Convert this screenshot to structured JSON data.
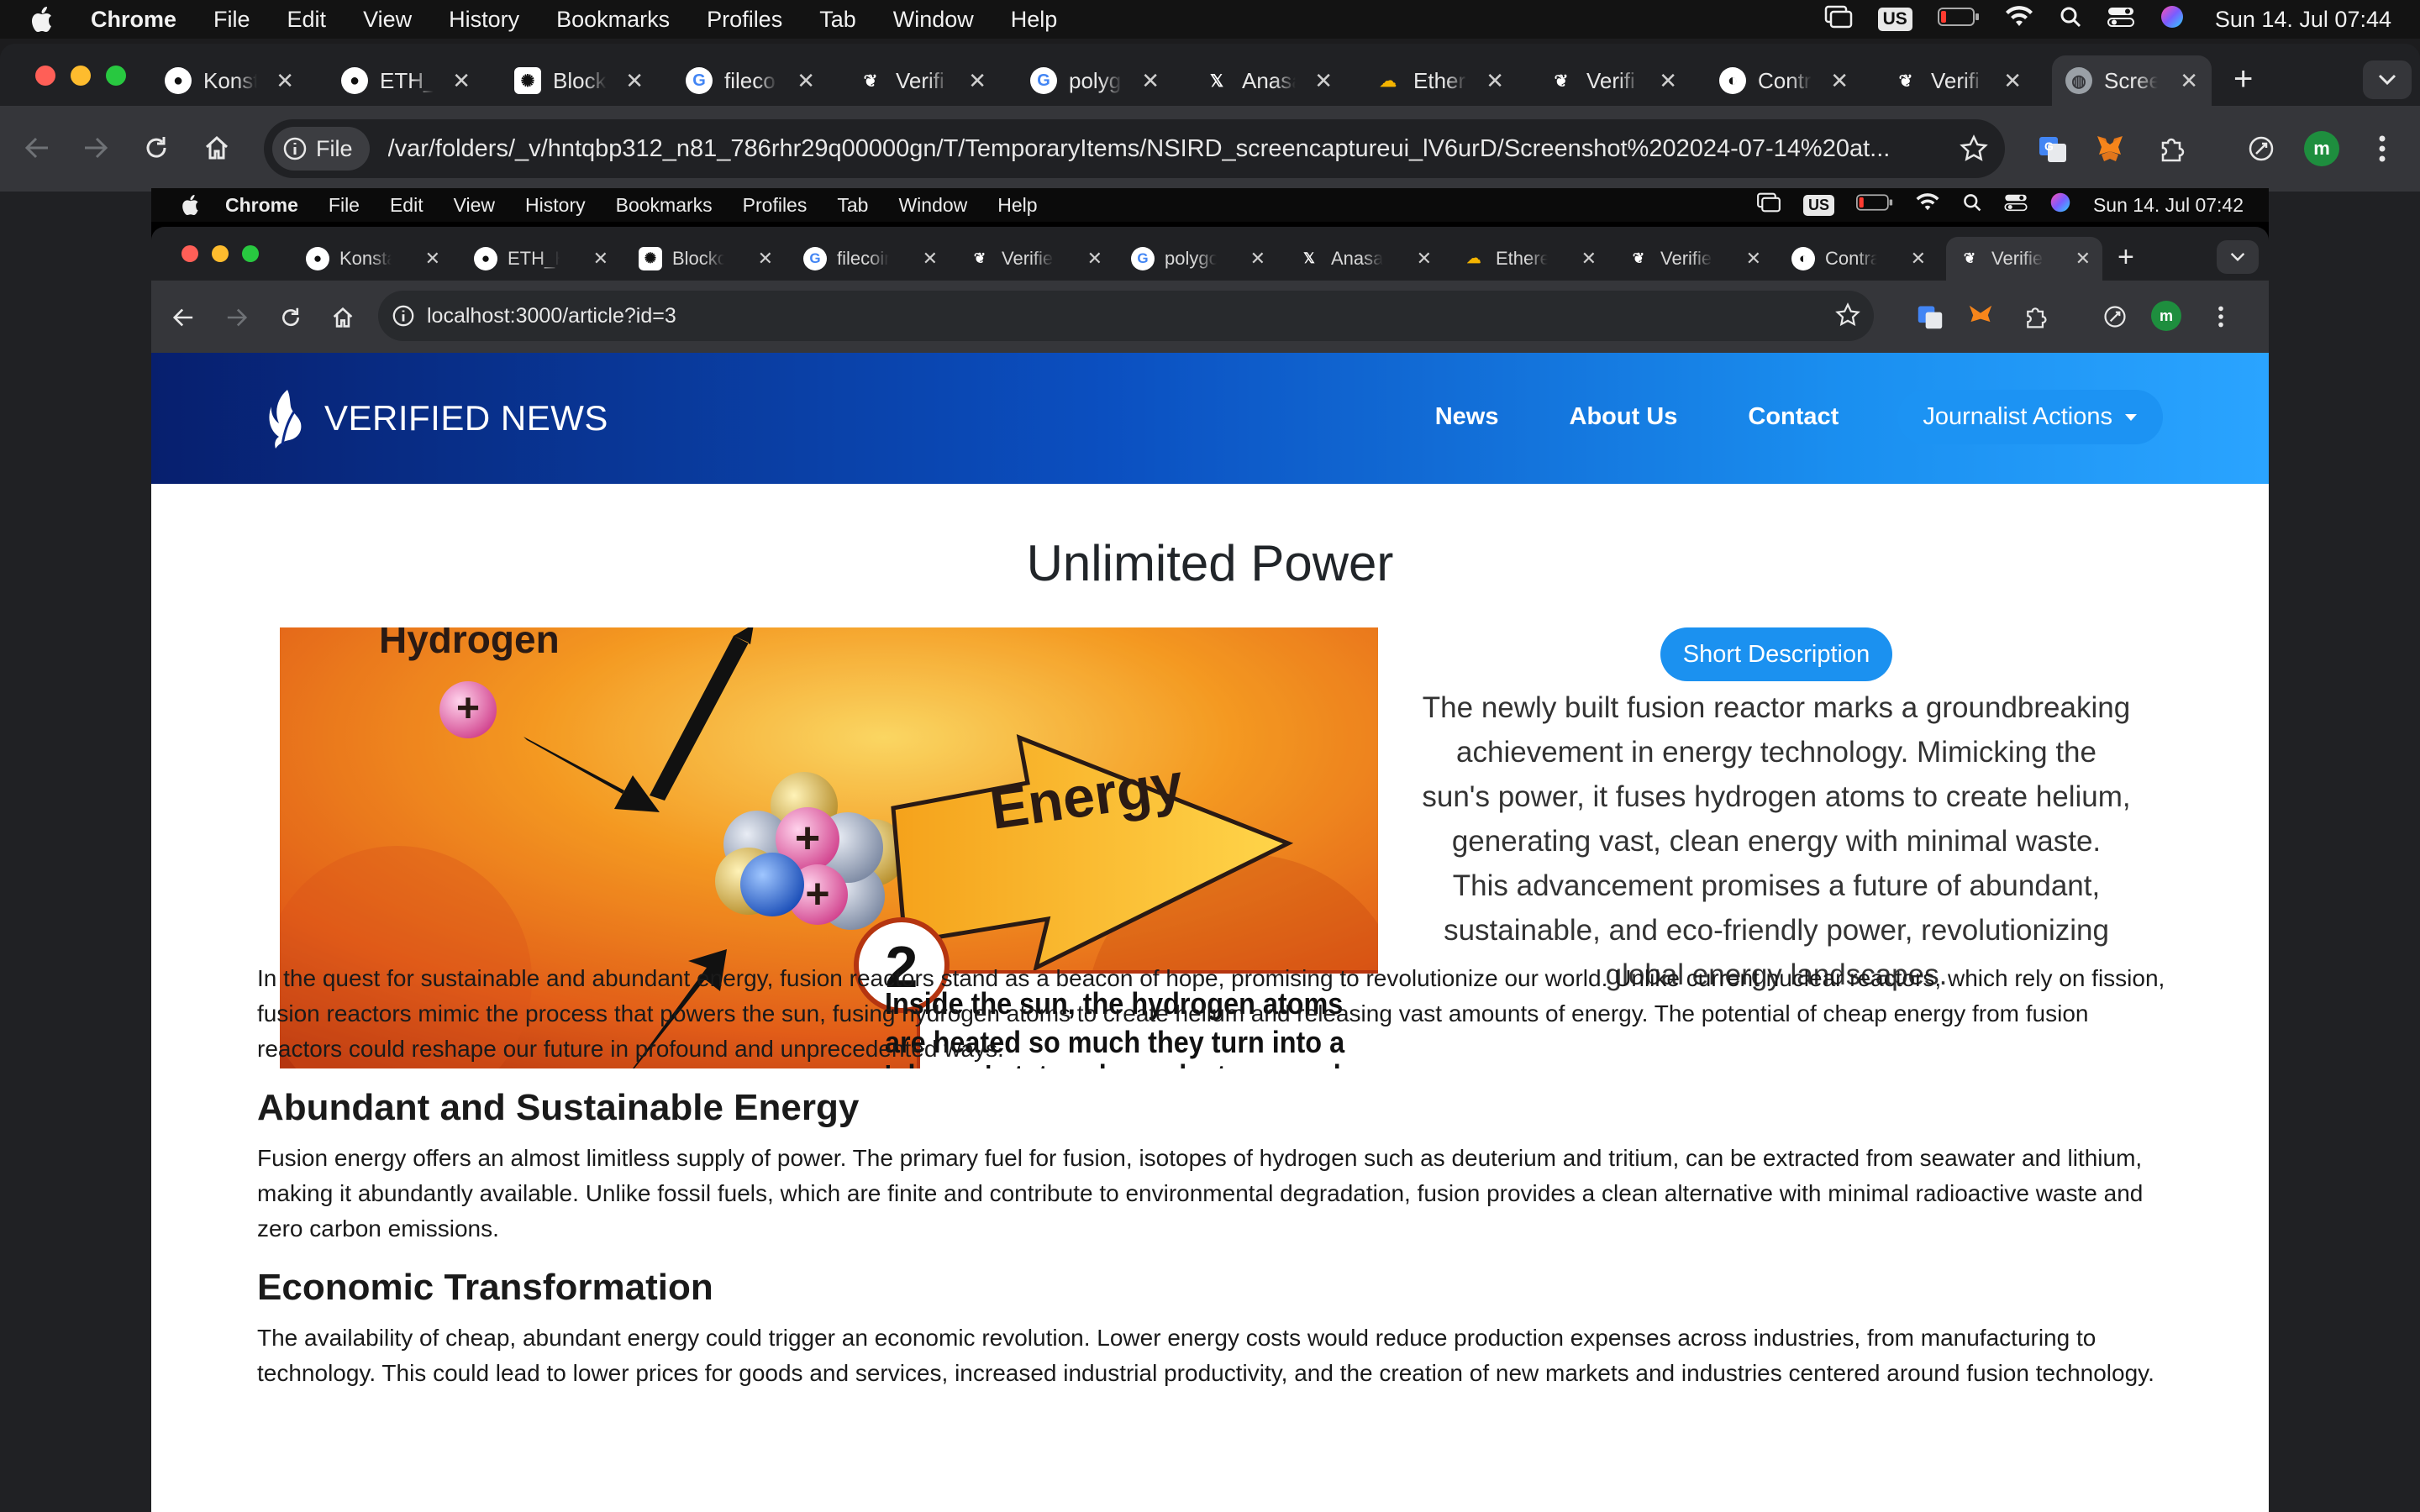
{
  "os_menubar": {
    "items": [
      "Chrome",
      "File",
      "Edit",
      "View",
      "History",
      "Bookmarks",
      "Profiles",
      "Tab",
      "Window",
      "Help"
    ],
    "keyboard": "US",
    "clock": "Sun 14. Jul 07:44"
  },
  "outer_browser": {
    "tabs": [
      "Konst",
      "ETH_",
      "Block",
      "fileco",
      "Verifi",
      "polyg",
      "Anasa",
      "Ether",
      "Verifi",
      "Contr",
      "Verifi",
      "Scree"
    ],
    "address_chip": "File",
    "url": "/var/folders/_v/hntqbp312_n81_786rhr29q00000gn/T/TemporaryItems/NSIRD_screencaptureui_lV6urD/Screenshot%202024-07-14%20at...",
    "profile_initial": "m"
  },
  "inner_menubar": {
    "items": [
      "Chrome",
      "File",
      "Edit",
      "View",
      "History",
      "Bookmarks",
      "Profiles",
      "Tab",
      "Window",
      "Help"
    ],
    "keyboard": "US",
    "clock": "Sun 14. Jul 07:42"
  },
  "inner_browser": {
    "tabs": [
      "Konsta",
      "ETH_H",
      "Blockcl",
      "filecoin",
      "Verified",
      "polygo",
      "Anasay",
      "Ethere",
      "Verifiec",
      "Contra",
      "Verified"
    ],
    "url": "localhost:3000/article?id=3",
    "profile_initial": "m"
  },
  "site": {
    "brand": "VERIFIED NEWS",
    "nav": {
      "news": "News",
      "about": "About Us",
      "contact": "Contact",
      "journalist": "Journalist Actions"
    }
  },
  "article": {
    "title": "Unlimited Power",
    "hero_labels": {
      "hydrogen": "Hydrogen",
      "energy": "Energy",
      "step": "2",
      "caption_1": "Inside the sun, the hydrogen atoms",
      "caption_2": "are heated so much they turn into a",
      "caption_3": "'plasma' state, where electrons no longer"
    },
    "short_button": "Short Description",
    "short_description": "The newly built fusion reactor marks a groundbreaking achievement in energy technology. Mimicking the sun's power, it fuses hydrogen atoms to create helium, generating vast, clean energy with minimal waste. This advancement promises a future of abundant, sustainable, and eco-friendly power, revolutionizing global energy landscapes.",
    "intro": "In the quest for sustainable and abundant energy, fusion reactors stand as a beacon of hope, promising to revolutionize our world. Unlike current nuclear reactors, which rely on fission, fusion reactors mimic the process that powers the sun, fusing hydrogen atoms to create helium and releasing vast amounts of energy. The potential of cheap energy from fusion reactors could reshape our future in profound and unprecedented ways.",
    "section1_heading": "Abundant and Sustainable Energy",
    "section1_text": "Fusion energy offers an almost limitless supply of power. The primary fuel for fusion, isotopes of hydrogen such as deuterium and tritium, can be extracted from seawater and lithium, making it abundantly available. Unlike fossil fuels, which are finite and contribute to environmental degradation, fusion provides a clean alternative with minimal radioactive waste and zero carbon emissions.",
    "section2_heading": "Economic Transformation",
    "section2_text": "The availability of cheap, abundant energy could trigger an economic revolution. Lower energy costs would reduce production expenses across industries, from manufacturing to technology. This could lead to lower prices for goods and services, increased industrial productivity, and the creation of new markets and industries centered around fusion technology."
  },
  "colors": {
    "header_start": "#071f6e",
    "header_end": "#2aa4ff",
    "button_blue": "#1b91f0"
  }
}
